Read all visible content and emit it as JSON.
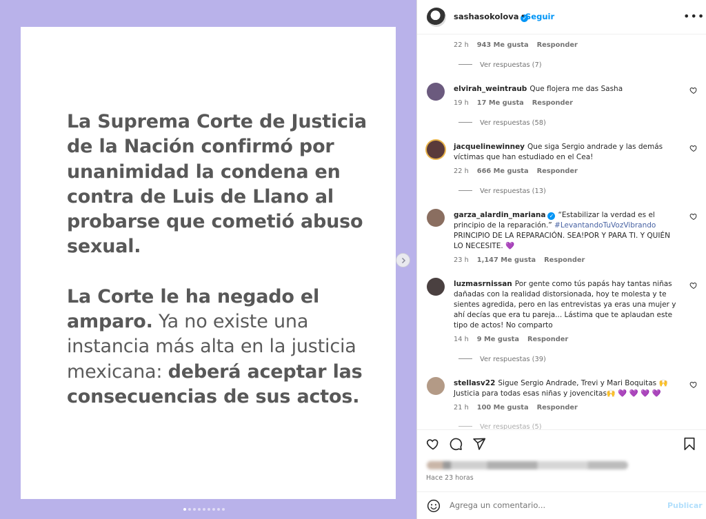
{
  "post": {
    "paragraph1": "La Suprema Corte de Justicia de la Nación confirmó por unanimidad la condena en contra de Luis de Llano al probarse que cometió abuso sexual.",
    "p2_bold1": "La Corte le ha negado el amparo.",
    "p2_regular": " Ya no existe una instancia más alta en la justicia mexicana: ",
    "p2_bold2": "deberá aceptar las consecuencias de sus actos."
  },
  "carousel": {
    "total": 9,
    "active": 0
  },
  "header": {
    "username": "sashasokolova",
    "separator": "•",
    "follow_label": "Seguir",
    "more_label": "•••"
  },
  "top_meta": {
    "time": "22 h",
    "likes": "943 Me gusta",
    "reply": "Responder"
  },
  "top_replies": "Ver respuestas (7)",
  "comments": [
    {
      "username": "elvirah_weintraub",
      "text": "Que flojera me das Sasha",
      "time": "19 h",
      "likes": "17 Me gusta",
      "reply": "Responder",
      "view_replies": "Ver respuestas (58)",
      "avatar_color": "#6b5a7e"
    },
    {
      "username": "jacquelinewinney",
      "text": "Que siga Sergio andrade y las demás víctimas que han estudiado en el Cea!",
      "time": "22 h",
      "likes": "666 Me gusta",
      "reply": "Responder",
      "view_replies": "Ver respuestas (13)",
      "avatar_color": "#5a3a3a"
    },
    {
      "username": "garza_alardin_mariana",
      "text_before": "“Estabilizar la verdad es el principio de la reparación.” ",
      "hashtag": "#LevantandoTuVozVibrando",
      "text_after": " PRINCIPIO DE LA REPARACIÓN. SEA!POR Y PARA TI. Y QUIÉN LO NECESITE. 💜",
      "time": "23 h",
      "likes": "1,147 Me gusta",
      "reply": "Responder",
      "avatar_color": "#8a6e60"
    },
    {
      "username": "luzmasrnissan",
      "text": "Por gente como tús papás hay tantas niñas dañadas con la realidad distorsionada, hoy te molesta y te sientes agredida, pero en las entrevistas ya eras una mujer y ahí decías que era tu pareja... Lástima que te aplaudan este tipo de actos! No comparto",
      "time": "14 h",
      "likes": "9 Me gusta",
      "reply": "Responder",
      "view_replies": "Ver respuestas (39)",
      "avatar_color": "#4a4040"
    },
    {
      "username": "stellasv22",
      "text": "Sigue Sergio Andrade, Trevi y Mari Boquitas 🙌 Justicia para todas esas niñas y jovencitas🙌  💜 💜 💜 💜",
      "time": "21 h",
      "likes": "100 Me gusta",
      "reply": "Responder",
      "view_replies": "Ver respuestas (5)",
      "avatar_color": "#b39a86"
    }
  ],
  "footer": {
    "time_ago": "Hace 23 horas",
    "comment_placeholder": "Agrega un comentario...",
    "publish_label": "Publicar"
  },
  "colors": {
    "panel_bg": "#b9b2ea",
    "link_blue": "#0095f6",
    "hashtag": "#4762a3"
  }
}
